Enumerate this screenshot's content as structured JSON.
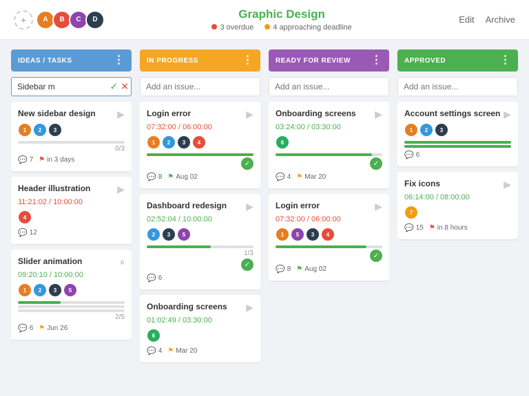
{
  "header": {
    "title": "Graphic Design",
    "meta_overdue": "3 overdue",
    "meta_deadline": "4 approaching deadline",
    "edit_label": "Edit",
    "archive_label": "Archive"
  },
  "columns": [
    {
      "id": "ideas",
      "label": "IDEAS / TASKS",
      "color": "ideas",
      "cards": [
        {
          "title": "New sidebar design",
          "time": null,
          "time_type": null,
          "avatars": [
            "sa1",
            "sa2",
            "sa3"
          ],
          "progress": [
            {
              "pct": 0,
              "color": "fill-green"
            }
          ],
          "progress_count": "0/3",
          "footer": [
            {
              "type": "badge",
              "icon": "💬",
              "value": "7"
            },
            {
              "type": "flag",
              "color": "flag-red",
              "value": "in 3 days"
            }
          ],
          "complete": false,
          "paused": false
        },
        {
          "title": "Header illustration",
          "time": "11:21:02 / 10:00:00",
          "time_type": "time-red",
          "avatars": [
            "sa4"
          ],
          "progress": [],
          "progress_count": null,
          "footer": [
            {
              "type": "badge",
              "icon": "💬",
              "value": "12"
            }
          ],
          "complete": false,
          "paused": false
        },
        {
          "title": "Slider animation",
          "time": "09:20:10 / 10:00:00",
          "time_type": "time-green",
          "avatars": [
            "sa1",
            "sa2",
            "sa3",
            "sa5"
          ],
          "progress": [
            {
              "pct": 40,
              "color": "fill-green"
            },
            {
              "pct": 0,
              "color": "fill-green"
            },
            {
              "pct": 0,
              "color": "fill-green"
            }
          ],
          "progress_count": "2/5",
          "footer": [
            {
              "type": "badge",
              "icon": "💬",
              "value": "6"
            },
            {
              "type": "flag",
              "color": "flag-yellow",
              "value": "Jun 26"
            }
          ],
          "complete": false,
          "paused": true
        }
      ]
    },
    {
      "id": "progress",
      "label": "IN PROGRESS",
      "color": "progress",
      "cards": [
        {
          "title": "Login error",
          "time": "07:32:00 / 06:00:00",
          "time_type": "time-red",
          "avatars": [
            "sa1",
            "sa2",
            "sa3",
            "sa4"
          ],
          "progress": [
            {
              "pct": 100,
              "color": "fill-green"
            }
          ],
          "progress_count": null,
          "footer": [
            {
              "type": "badge",
              "icon": "💬",
              "value": "8"
            },
            {
              "type": "flag",
              "color": "flag-green",
              "value": "Aug 02"
            }
          ],
          "complete": true,
          "paused": false
        },
        {
          "title": "Dashboard redesign",
          "time": "02:52:04 / 10:00:00",
          "time_type": "time-green",
          "avatars": [
            "sa2",
            "sa3",
            "sa5"
          ],
          "progress": [
            {
              "pct": 60,
              "color": "fill-green"
            }
          ],
          "progress_count": "1/3",
          "footer": [
            {
              "type": "badge",
              "icon": "💬",
              "value": "6"
            }
          ],
          "complete": true,
          "paused": false
        },
        {
          "title": "Onboarding screens",
          "time": "01:02:49 / 03:30:00",
          "time_type": "time-green",
          "avatars": [
            "sa6"
          ],
          "progress": [],
          "progress_count": null,
          "footer": [
            {
              "type": "badge",
              "icon": "💬",
              "value": "4"
            },
            {
              "type": "flag",
              "color": "flag-yellow",
              "value": "Mar 20"
            }
          ],
          "complete": false,
          "paused": false
        }
      ]
    },
    {
      "id": "review",
      "label": "READY FOR REVIEW",
      "color": "review",
      "cards": [
        {
          "title": "Onboarding screens",
          "time": "03:24:00 / 03:30:00",
          "time_type": "time-green",
          "avatars": [
            "sa6"
          ],
          "progress": [
            {
              "pct": 90,
              "color": "fill-green"
            }
          ],
          "progress_count": null,
          "footer": [
            {
              "type": "badge",
              "icon": "💬",
              "value": "4"
            },
            {
              "type": "flag",
              "color": "flag-yellow",
              "value": "Mar 20"
            }
          ],
          "complete": true,
          "paused": false
        },
        {
          "title": "Login error",
          "time": "07:32:00 / 06:00:00",
          "time_type": "time-red",
          "avatars": [
            "sa1",
            "sa5",
            "sa3",
            "sa4"
          ],
          "progress": [
            {
              "pct": 85,
              "color": "fill-green"
            }
          ],
          "progress_count": null,
          "footer": [
            {
              "type": "badge",
              "icon": "💬",
              "value": "8"
            },
            {
              "type": "flag",
              "color": "flag-green",
              "value": "Aug 02"
            }
          ],
          "complete": true,
          "paused": false
        }
      ]
    },
    {
      "id": "approved",
      "label": "APPROVED",
      "color": "approved",
      "cards": [
        {
          "title": "Account settings screen",
          "time": null,
          "time_type": null,
          "avatars": [
            "sa1",
            "sa2",
            "sa3"
          ],
          "progress": [
            {
              "pct": 100,
              "color": "fill-green"
            },
            {
              "pct": 100,
              "color": "fill-green"
            }
          ],
          "progress_count": null,
          "footer": [
            {
              "type": "badge",
              "icon": "💬",
              "value": "6"
            }
          ],
          "complete": false,
          "paused": false
        },
        {
          "title": "Fix icons",
          "time": "06:14:00 / 08:00:00",
          "time_type": "time-green",
          "avatars": [
            "sa7"
          ],
          "progress": [],
          "progress_count": null,
          "footer": [
            {
              "type": "badge",
              "icon": "💬",
              "value": "15"
            },
            {
              "type": "flag",
              "color": "flag-red",
              "value": "in 8 hours"
            }
          ],
          "complete": false,
          "paused": false
        }
      ]
    }
  ],
  "add_issue_placeholder": "Add an issue...",
  "sidebar_input_value": "Sidebar m",
  "column_dots": "⋮"
}
